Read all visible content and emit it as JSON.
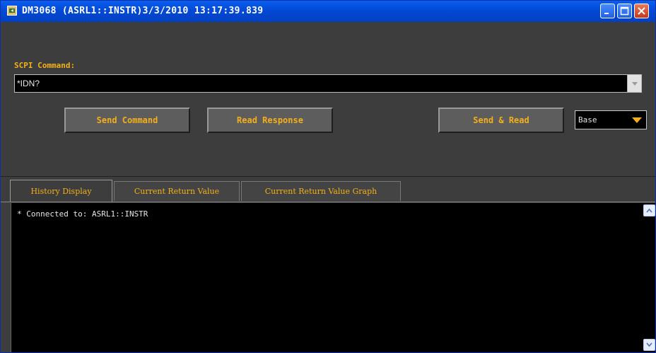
{
  "window": {
    "title": "DM3068 (ASRL1::INSTR)3/3/2010 13:17:39.839",
    "controls": {
      "minimize_icon": "minimize-icon",
      "maximize_icon": "maximize-icon",
      "close_icon": "close-icon"
    }
  },
  "scpi": {
    "label": "SCPI Command:",
    "value": "*IDN?"
  },
  "buttons": {
    "send": "Send Command",
    "read": "Read Response",
    "send_read": "Send & Read"
  },
  "base_select": {
    "value": "Base"
  },
  "tabs": [
    {
      "label": "History Display",
      "active": true
    },
    {
      "label": "Current Return Value",
      "active": false
    },
    {
      "label": "Current Return Value Graph",
      "active": false
    }
  ],
  "history": {
    "lines": "* Connected to: ASRL1::INSTR"
  },
  "colors": {
    "accent": "#f3b01c",
    "panel": "#3d3d3d",
    "titlebar": "#0349d6"
  }
}
